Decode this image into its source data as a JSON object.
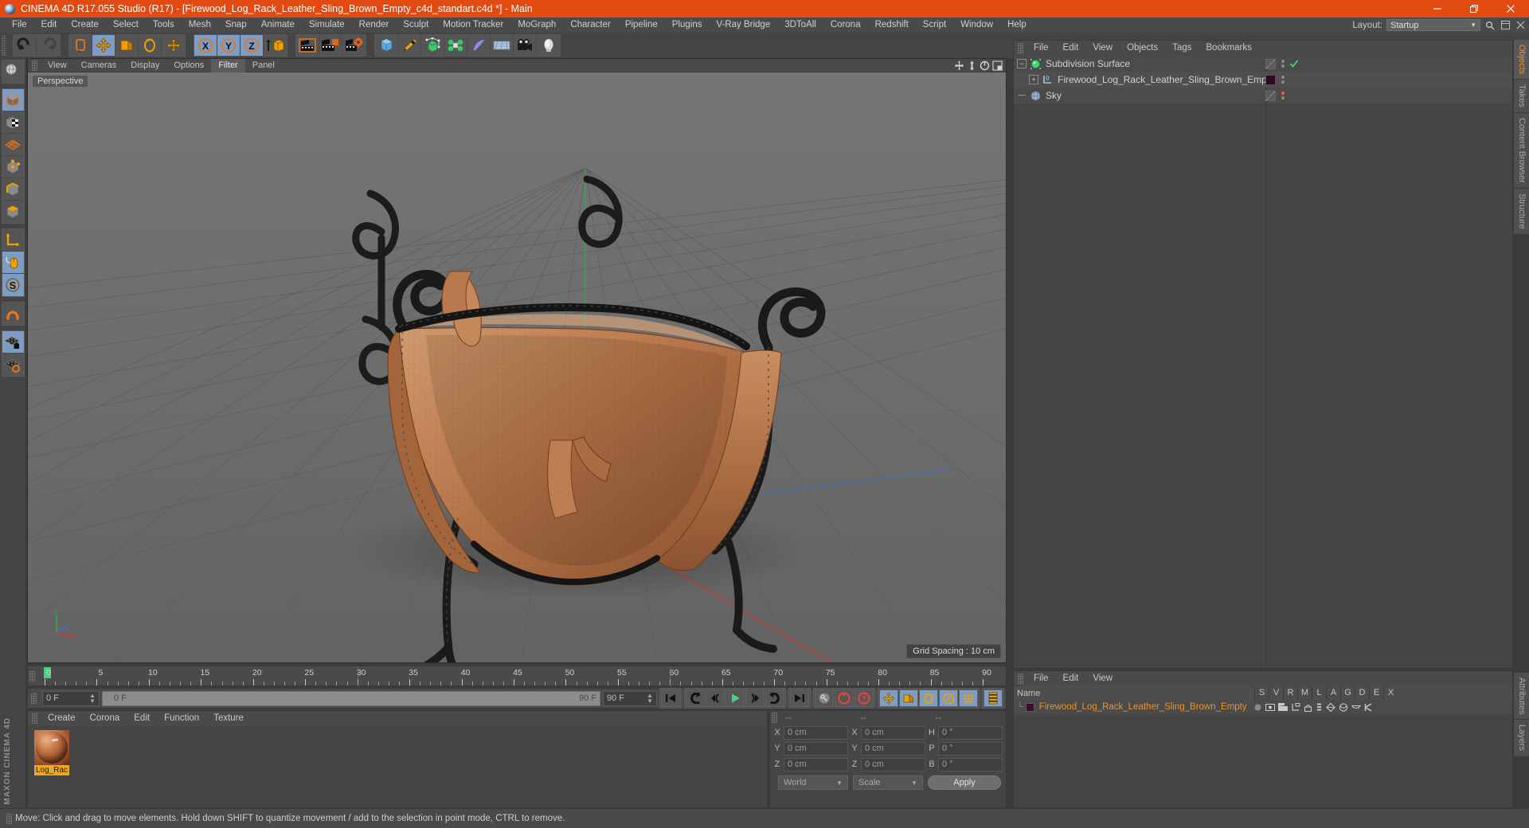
{
  "window": {
    "title": "CINEMA 4D R17.055 Studio (R17) - [Firewood_Log_Rack_Leather_Sling_Brown_Empty_c4d_standart.c4d *] - Main",
    "minimize": "—",
    "maximize": "❐",
    "close": "✕",
    "titlebar_color": "#e24a12"
  },
  "menubar": {
    "items": [
      {
        "label": "File"
      },
      {
        "label": "Edit"
      },
      {
        "label": "Create"
      },
      {
        "label": "Select"
      },
      {
        "label": "Tools"
      },
      {
        "label": "Mesh"
      },
      {
        "label": "Snap"
      },
      {
        "label": "Animate"
      },
      {
        "label": "Simulate"
      },
      {
        "label": "Render"
      },
      {
        "label": "Sculpt"
      },
      {
        "label": "Motion Tracker"
      },
      {
        "label": "MoGraph"
      },
      {
        "label": "Character"
      },
      {
        "label": "Pipeline"
      },
      {
        "label": "Plugins"
      },
      {
        "label": "V-Ray Bridge"
      },
      {
        "label": "3DToAll"
      },
      {
        "label": "Corona"
      },
      {
        "label": "Redshift"
      },
      {
        "label": "Script"
      },
      {
        "label": "Window"
      },
      {
        "label": "Help"
      }
    ],
    "layout_label": "Layout:",
    "layout_value": "Startup",
    "search_icon": "search-icon"
  },
  "toolbar": {
    "groups": [
      {
        "name": "undo-redo",
        "buttons": [
          {
            "name": "undo-button",
            "icon": "undo-icon"
          },
          {
            "name": "redo-button",
            "icon": "redo-icon"
          }
        ]
      },
      {
        "name": "selection-transform",
        "buttons": [
          {
            "name": "live-selection-button",
            "icon": "live-selection-icon"
          },
          {
            "name": "move-tool-button",
            "icon": "move-icon",
            "active": true
          },
          {
            "name": "scale-tool-button",
            "icon": "scale-icon"
          },
          {
            "name": "rotate-tool-button",
            "icon": "rotate-icon"
          },
          {
            "name": "move-axis-button",
            "icon": "move-axis-icon"
          }
        ]
      },
      {
        "name": "axis-locks",
        "buttons": [
          {
            "name": "x-axis-lock-button",
            "icon": "x-axis-icon",
            "active": true
          },
          {
            "name": "y-axis-lock-button",
            "icon": "y-axis-icon",
            "active": true
          },
          {
            "name": "z-axis-lock-button",
            "icon": "z-axis-icon",
            "active": true
          },
          {
            "name": "world-object-coord-button",
            "icon": "world-coord-icon"
          }
        ]
      },
      {
        "name": "render",
        "buttons": [
          {
            "name": "render-view-button",
            "icon": "render-view-icon"
          },
          {
            "name": "render-to-picture-viewer-button",
            "icon": "render-picture-icon"
          },
          {
            "name": "render-settings-button",
            "icon": "render-settings-icon"
          }
        ]
      },
      {
        "name": "create-objects",
        "buttons": [
          {
            "name": "add-cube-button",
            "icon": "cube-icon"
          },
          {
            "name": "add-spline-button",
            "icon": "pen-spline-icon"
          },
          {
            "name": "add-generator-button",
            "icon": "generator-icon"
          },
          {
            "name": "add-mograph-button",
            "icon": "mograph-icon"
          },
          {
            "name": "add-deformer-button",
            "icon": "deformer-icon"
          },
          {
            "name": "add-environment-button",
            "icon": "environment-icon"
          },
          {
            "name": "add-camera-button",
            "icon": "camera-icon"
          },
          {
            "name": "add-light-button",
            "icon": "light-icon"
          }
        ]
      }
    ]
  },
  "leftbar": {
    "groups": [
      {
        "buttons": [
          {
            "name": "deformed-editing-button",
            "icon": "globe-wireframe-icon"
          }
        ]
      },
      {
        "buttons": [
          {
            "name": "model-mode-button",
            "icon": "model-cube-icon",
            "active": true
          },
          {
            "name": "texture-mode-button",
            "icon": "texture-checker-icon"
          },
          {
            "name": "workplane-mode-button",
            "icon": "workplane-icon"
          },
          {
            "name": "points-mode-button",
            "icon": "points-icon"
          },
          {
            "name": "edges-mode-button",
            "icon": "edges-icon"
          },
          {
            "name": "polygons-mode-button",
            "icon": "polygons-icon"
          }
        ]
      },
      {
        "buttons": [
          {
            "name": "object-axis-button",
            "icon": "axis-icon"
          },
          {
            "name": "viewport-solo-button",
            "icon": "mouse-icon",
            "active": true
          },
          {
            "name": "enable-snap-button",
            "icon": "snap-s-icon",
            "active": true
          }
        ]
      },
      {
        "buttons": [
          {
            "name": "magnet-button",
            "icon": "magnet-icon"
          }
        ]
      },
      {
        "buttons": [
          {
            "name": "workplane-lock-button",
            "icon": "grid-lock-icon",
            "active": true
          },
          {
            "name": "workplane-toggle-button",
            "icon": "grid-toggle-icon"
          }
        ]
      }
    ],
    "brand_line1": "MAXON",
    "brand_line2": "CINEMA 4D"
  },
  "viewport": {
    "menu": [
      {
        "label": "View"
      },
      {
        "label": "Cameras"
      },
      {
        "label": "Display"
      },
      {
        "label": "Options"
      },
      {
        "label": "Filter",
        "selected": true
      },
      {
        "label": "Panel"
      }
    ],
    "label": "Perspective",
    "grid_spacing": "Grid Spacing : 10 cm",
    "axis_x": "X",
    "axis_y": "Y",
    "axis_z": "Z",
    "nav_icons": [
      "pan-icon",
      "dolly-icon",
      "rotate-view-icon",
      "maximize-view-icon"
    ]
  },
  "object_manager": {
    "menu": [
      {
        "label": "File"
      },
      {
        "label": "Edit"
      },
      {
        "label": "View"
      },
      {
        "label": "Objects"
      },
      {
        "label": "Tags"
      },
      {
        "label": "Bookmarks"
      }
    ],
    "items": [
      {
        "name": "Subdivision Surface",
        "icon": "subdivision-surface-icon",
        "depth": 0,
        "expander": "−",
        "tag_color": "none",
        "state_dot": "#4fd46f"
      },
      {
        "name": "Firewood_Log_Rack_Leather_Sling_Brown_Empty",
        "icon": "null-object-icon",
        "depth": 1,
        "expander": "+",
        "tag_color": "#2d0a22",
        "state_dot": "#8a8a8a"
      },
      {
        "name": "Sky",
        "icon": "sky-icon",
        "depth": 0,
        "expander": "",
        "tag_color": "none",
        "state_dot": "#f25a4b"
      }
    ]
  },
  "right_tabs": {
    "top": [
      {
        "label": "Objects",
        "active": true
      },
      {
        "label": "Takes",
        "active": false
      },
      {
        "label": "Content Browser",
        "active": false
      },
      {
        "label": "Structure",
        "active": false
      }
    ],
    "bottom": [
      {
        "label": "Attributes",
        "active": false
      },
      {
        "label": "Layers",
        "active": false
      }
    ]
  },
  "timeline": {
    "ticks": [
      0,
      5,
      10,
      15,
      20,
      25,
      30,
      35,
      40,
      45,
      50,
      55,
      60,
      65,
      70,
      75,
      80,
      85,
      90
    ],
    "current_frame_label": "0 F",
    "playhead_frame": 0,
    "min_frame": 0,
    "max_frame": 90
  },
  "transport": {
    "current_frame": "0 F",
    "range_start": "0 F",
    "range_end": "90 F",
    "end_frame": "90 F",
    "buttons": [
      {
        "name": "go-to-start-button",
        "icon": "skip-start-icon"
      },
      {
        "name": "previous-keyframe-button",
        "icon": "prev-key-icon"
      },
      {
        "name": "step-back-button",
        "icon": "step-back-icon"
      },
      {
        "name": "play-button",
        "icon": "play-icon"
      },
      {
        "name": "step-forward-button",
        "icon": "step-forward-icon"
      },
      {
        "name": "next-keyframe-button",
        "icon": "next-key-icon"
      },
      {
        "name": "go-to-end-button",
        "icon": "skip-end-icon"
      }
    ],
    "record_buttons": [
      {
        "name": "autokey-button",
        "icon": "key-icon"
      },
      {
        "name": "record-active-objects-button",
        "icon": "record-icon"
      },
      {
        "name": "keyframe-selection-button",
        "icon": "question-icon"
      }
    ],
    "param_buttons": [
      {
        "name": "record-position-button",
        "icon": "position-icon",
        "active": true
      },
      {
        "name": "record-scale-button",
        "icon": "scale-key-icon",
        "active": true
      },
      {
        "name": "record-rotation-button",
        "icon": "rotation-key-icon",
        "active": true
      },
      {
        "name": "record-pla-button",
        "icon": "pla-icon",
        "active": true
      },
      {
        "name": "record-parameter-button",
        "icon": "param-dots-icon",
        "active": true
      }
    ],
    "extra_button": {
      "name": "timeline-view-button",
      "icon": "filmstrip-icon"
    }
  },
  "material_manager": {
    "menu": [
      {
        "label": "Create"
      },
      {
        "label": "Corona"
      },
      {
        "label": "Edit"
      },
      {
        "label": "Function"
      },
      {
        "label": "Texture"
      }
    ],
    "materials": [
      {
        "name": "Log_Rack",
        "display": "Log_Rac"
      }
    ]
  },
  "coordinates": {
    "headers": [
      "--",
      "--",
      "--"
    ],
    "rows": [
      {
        "label1": "X",
        "value1": "0 cm",
        "label2": "X",
        "value2": "0 cm",
        "label3": "H",
        "value3": "0 °"
      },
      {
        "label1": "Y",
        "value1": "0 cm",
        "label2": "Y",
        "value2": "0 cm",
        "label3": "P",
        "value3": "0 °"
      },
      {
        "label1": "Z",
        "value1": "0 cm",
        "label2": "Z",
        "value2": "0 cm",
        "label3": "B",
        "value3": "0 °"
      }
    ],
    "system": "World",
    "mode": "Scale",
    "apply": "Apply"
  },
  "layer_manager": {
    "menu": [
      {
        "label": "File"
      },
      {
        "label": "Edit"
      },
      {
        "label": "View"
      }
    ],
    "columns": [
      "Name",
      "S",
      "V",
      "R",
      "M",
      "L",
      "A",
      "G",
      "D",
      "E",
      "X"
    ],
    "rows": [
      {
        "name": "Firewood_Log_Rack_Leather_Sling_Brown_Empty",
        "color": "#3b0f2c"
      }
    ]
  },
  "statusbar": {
    "message": "Move: Click and drag to move elements. Hold down SHIFT to quantize movement / add to the selection in point mode, CTRL to remove."
  }
}
